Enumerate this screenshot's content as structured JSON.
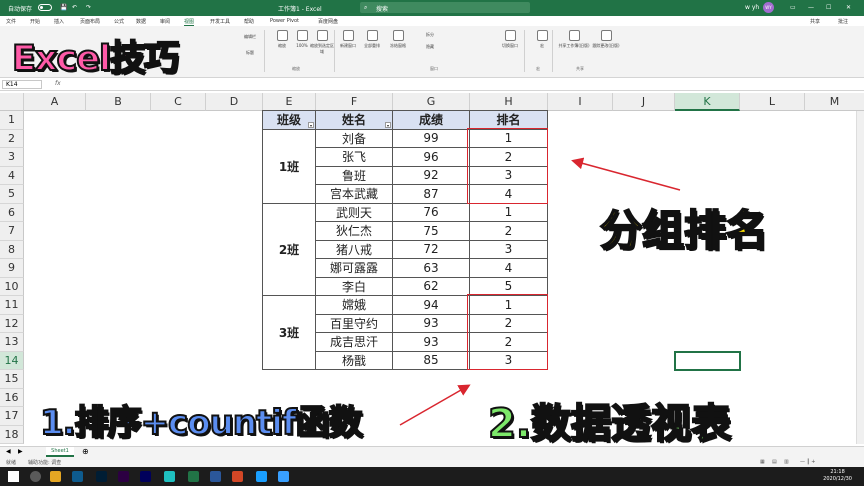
{
  "titlebar": {
    "autosave": "自动保存",
    "title": "工作簿1 - Excel",
    "search": "搜索",
    "user": "w yh",
    "avatar": "WY"
  },
  "menu": {
    "items": [
      "文件",
      "开始",
      "插入",
      "页面布局",
      "公式",
      "数据",
      "审阅",
      "视图",
      "开发工具",
      "帮助",
      "Power Pivot",
      "百度网盘"
    ],
    "active_index": 7,
    "share": "共享",
    "comments": "批注"
  },
  "ribbon": {
    "buttons": [
      "编辑栏",
      "标题",
      "缩放",
      "100%",
      "缩放到选定区域",
      "新建窗口",
      "全部重排",
      "冻结窗格",
      "拆分",
      "隐藏",
      "切换窗口",
      "宏",
      "共享工作簿(旧版)",
      "跟踪更改(旧版)"
    ],
    "groups": [
      "缩放",
      "窗口",
      "宏",
      "共享"
    ]
  },
  "formulabar": {
    "namebox": "K14",
    "fx": "fx"
  },
  "grid": {
    "columns": [
      "A",
      "B",
      "C",
      "D",
      "E",
      "F",
      "G",
      "H",
      "I",
      "J",
      "K",
      "L",
      "M"
    ],
    "selected_column": "K",
    "rows": [
      "1",
      "2",
      "3",
      "4",
      "5",
      "6",
      "7",
      "8",
      "9",
      "10",
      "11",
      "12",
      "13",
      "14",
      "15",
      "16",
      "17",
      "18"
    ],
    "selected_row": "14",
    "table_headers": [
      "班级",
      "姓名",
      "成绩",
      "排名"
    ],
    "classes": [
      "1班",
      "2班",
      "3班"
    ],
    "records": [
      [
        "刘备",
        "99",
        "1"
      ],
      [
        "张飞",
        "96",
        "2"
      ],
      [
        "鲁班",
        "92",
        "3"
      ],
      [
        "宫本武藏",
        "87",
        "4"
      ],
      [
        "武则天",
        "76",
        "1"
      ],
      [
        "狄仁杰",
        "75",
        "2"
      ],
      [
        "猪八戒",
        "72",
        "3"
      ],
      [
        "娜可露露",
        "63",
        "4"
      ],
      [
        "李白",
        "62",
        "5"
      ],
      [
        "嫦娥",
        "94",
        "1"
      ],
      [
        "百里守约",
        "93",
        "2"
      ],
      [
        "成吉思汗",
        "93",
        "2"
      ],
      [
        "杨戬",
        "85",
        "3"
      ]
    ]
  },
  "sheets": {
    "tabs": [
      "Sheet1"
    ],
    "active": "Sheet1"
  },
  "status": {
    "ready": "就绪",
    "accessibility": "辅助功能: 调查"
  },
  "taskbar": {
    "time": "21:18",
    "date": "2020/12/30"
  },
  "overlays": {
    "excel_tips": "Excel技巧",
    "group_rank": "分组排名",
    "method1": "1.排序+countif函数",
    "method2": "2.数据透视表"
  }
}
